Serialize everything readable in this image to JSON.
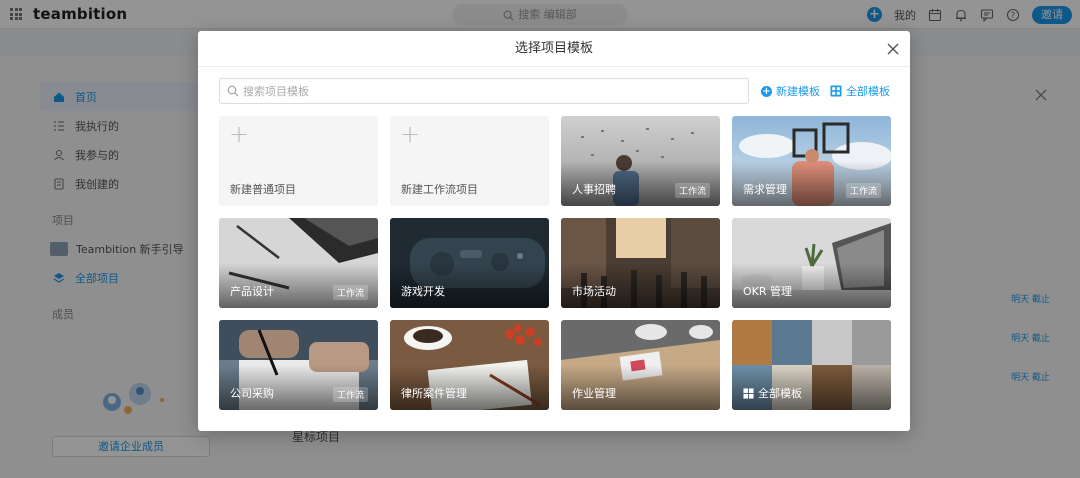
{
  "app": {
    "brand": "teambition",
    "search_placeholder": "搜索 编辑部",
    "nav_mine": "我的",
    "invite_label": "邀请"
  },
  "sidebar": {
    "items": [
      {
        "label": "首页",
        "icon": "home-icon",
        "active": true
      },
      {
        "label": "我执行的",
        "icon": "list-icon"
      },
      {
        "label": "我参与的",
        "icon": "user-icon"
      },
      {
        "label": "我创建的",
        "icon": "doc-icon"
      }
    ],
    "projects_heading": "项目",
    "projects": [
      {
        "label": "Teambition 新手引导",
        "icon": "project-thumb-icon"
      },
      {
        "label": "全部项目",
        "icon": "layers-icon",
        "active": true
      }
    ],
    "members_heading": "成员",
    "invite_company": "邀请企业成员"
  },
  "background": {
    "row_labels": [
      "明天 截止",
      "明天 截止",
      "明天 截止"
    ],
    "starred_heading": "星标项目"
  },
  "modal": {
    "title": "选择项目模板",
    "search_placeholder": "搜索项目模板",
    "new_template": "新建模板",
    "all_templates": "全部模板",
    "cards": [
      {
        "name": "新建普通项目",
        "kind": "blank"
      },
      {
        "name": "新建工作流项目",
        "kind": "blank"
      },
      {
        "name": "人事招聘",
        "tag": "工作流",
        "scene": "recruit"
      },
      {
        "name": "需求管理",
        "tag": "工作流",
        "scene": "demand"
      },
      {
        "name": "产品设计",
        "tag": "工作流",
        "scene": "product"
      },
      {
        "name": "游戏开发",
        "scene": "game"
      },
      {
        "name": "市场活动",
        "scene": "market"
      },
      {
        "name": "OKR 管理",
        "scene": "okr"
      },
      {
        "name": "公司采购",
        "tag": "工作流",
        "scene": "purchase"
      },
      {
        "name": "律所案件管理",
        "scene": "law"
      },
      {
        "name": "作业管理",
        "scene": "homework"
      },
      {
        "name": "全部模板",
        "scene": "all",
        "icon": "grid-icon"
      }
    ]
  },
  "colors": {
    "accent": "#1b9aee"
  }
}
